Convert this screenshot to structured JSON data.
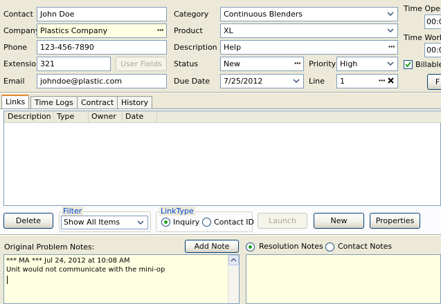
{
  "contact": {
    "contact_label": "Contact",
    "contact_value": "John Doe",
    "company_label": "Company",
    "company_value": "Plastics Company",
    "phone_label": "Phone",
    "phone_value": "123-456-7890",
    "extension_label": "Extension",
    "extension_value": "321",
    "user_fields_label": "User Fields",
    "email_label": "Email",
    "email_value": "johndoe@plastic.com"
  },
  "ticket": {
    "category_label": "Category",
    "category_value": "Continuous Blenders",
    "product_label": "Product",
    "product_value": "XL",
    "description_label": "Description",
    "description_value": "Help",
    "status_label": "Status",
    "status_value": "New",
    "priority_label": "Priority",
    "priority_value": "High",
    "due_date_label": "Due Date",
    "due_date_value": "7/25/2012",
    "line_label": "Line",
    "line_value": "1"
  },
  "time": {
    "opened_label": "Time Opene",
    "opened_value": "00:0",
    "worked_label": "Time Worke",
    "worked_value": "00:0",
    "billable_label": "Billable",
    "billable_checked": true
  },
  "tabs": [
    {
      "label": "Links"
    },
    {
      "label": "Time Logs"
    },
    {
      "label": "Contract"
    },
    {
      "label": "History"
    }
  ],
  "links_table": {
    "columns": [
      "Description",
      "Type",
      "Owner",
      "Date"
    ]
  },
  "links_toolbar": {
    "delete_label": "Delete",
    "filter_title": "Filter",
    "filter_value": "Show All Items",
    "linktype_title": "LinkType",
    "inquiry_label": "Inquiry",
    "contact_id_label": "Contact ID",
    "launch_label": "Launch",
    "new_label": "New",
    "properties_label": "Properties"
  },
  "notes": {
    "original_label": "Original Problem Notes:",
    "add_note_label": "Add Note",
    "resolution_label": "Resolution Notes",
    "contact_notes_label": "Contact Notes",
    "original_line1": "*** MA ***  Jul 24, 2012 at 10:08 AM",
    "original_line2": "Unit would not communicate with the mini-op"
  }
}
